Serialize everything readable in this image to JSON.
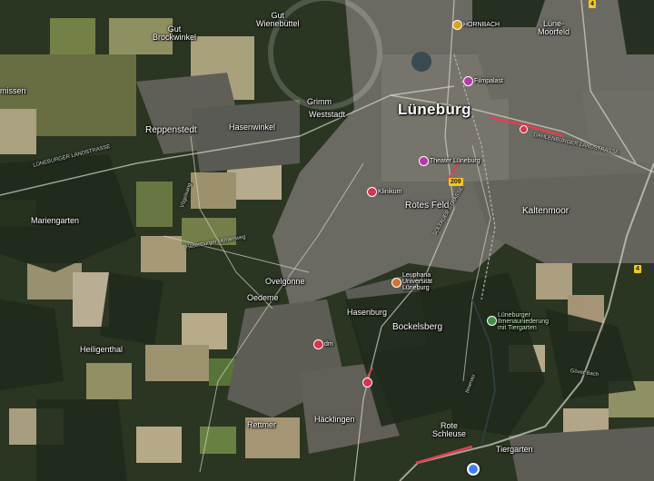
{
  "map": {
    "places": {
      "gut_brockwinkel": "Gut\nBrockwinkel",
      "gut_wienebuttel": "Gut\nWienebüttel",
      "missen": "missen",
      "grimm": "Grimm",
      "weststadt": "Weststadt",
      "luneburg": "Lüneburg",
      "lune_moorfeld": "Lüne-\nMoorfeld",
      "reppenstedt": "Reppenstedt",
      "hasenwinkel": "Hasenwinkel",
      "mariengarten": "Mariengarten",
      "rotes_feld": "Rotes Feld",
      "kaltenmoor": "Kaltenmoor",
      "ovelgonne": "Ovelgönne",
      "oedeme": "Oedeme",
      "hasenburg": "Hasenburg",
      "bockelsberg": "Bockelsberg",
      "heiligenthal": "Heiligenthal",
      "rettmer": "Rettmer",
      "hacklingen": "Häcklingen",
      "rote_schleuse": "Rote\nSchleuse",
      "tiergarten": "Tiergarten"
    },
    "pois": {
      "hornbach": "HORNBACH",
      "filmpalast": "Filmpalast",
      "theater": "Theater Lüneburg",
      "klinikum": "Klinikum",
      "leuphana": "Leuphana\nUniversität\nLüneburg",
      "dm": "dm",
      "nature_reserve": "Lüneburger\nIlmenauniederung\nmit Tiergarten"
    },
    "roads": {
      "luneburger_landstrasse": "LÜNEBURGER LANDSTRASSE",
      "dahlenburger_landstrasse": "DAHLENBURGER LANDSTRASSE",
      "vogelsang": "Vögelsang",
      "soltauer_strasse": "SOLTAUER STRASSE",
      "hasenburger_muhlenweg": "Hasenburger Mühlenweg",
      "ilmenau": "Ilmenau",
      "gover_bach": "Göver Bach"
    },
    "shields": {
      "b209": "209",
      "b4_top": "4",
      "b4_right": "4"
    },
    "colors": {
      "forest": "#23311f",
      "urban": "#6c6a62",
      "field": "#b5a57f",
      "route": "#e23f4e",
      "location": "#3b82f6"
    }
  }
}
